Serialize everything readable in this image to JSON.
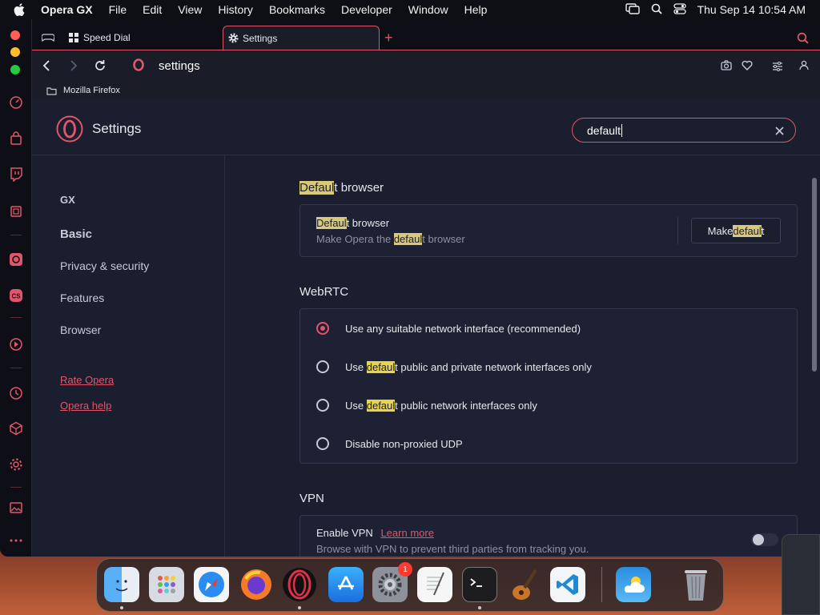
{
  "menubar": {
    "app_name": "Opera GX",
    "menus": [
      "File",
      "Edit",
      "View",
      "History",
      "Bookmarks",
      "Developer",
      "Window",
      "Help"
    ],
    "clock": "Thu Sep 14  10:54 AM"
  },
  "tabs": [
    {
      "label": "Speed Dial",
      "icon": "grid-icon"
    },
    {
      "label": "Settings",
      "icon": "gear-icon"
    }
  ],
  "toolbar": {
    "address": "settings"
  },
  "bookmarks": [
    {
      "label": "Mozilla Firefox",
      "icon": "folder-icon"
    }
  ],
  "settings_header": {
    "title": "Settings"
  },
  "search": {
    "value": "default"
  },
  "nav": {
    "items": [
      "GX",
      "Basic",
      "Privacy & security",
      "Features",
      "Browser"
    ],
    "links": [
      "Rate Opera",
      "Opera help"
    ]
  },
  "sections": {
    "default_browser": {
      "title_hl": "Defaul",
      "title_rest": "t browser",
      "row_title_hl": "Defaul",
      "row_title_rest": "t browser",
      "row_desc_pre": "Make Opera the ",
      "row_desc_hl": "defaul",
      "row_desc_rest": "t browser",
      "button_pre": "Make ",
      "button_hl": "defaul",
      "button_rest": "t"
    },
    "webrtc": {
      "title": "WebRTC",
      "options": [
        {
          "pre": "Use any suitable network interface (recommended)",
          "hl": "",
          "post": "",
          "selected": true
        },
        {
          "pre": "Use ",
          "hl": "defaul",
          "post": "t public and private network interfaces only",
          "selected": false
        },
        {
          "pre": "Use ",
          "hl": "defaul",
          "post": "t public network interfaces only",
          "selected": false
        },
        {
          "pre": "Disable non-proxied UDP",
          "hl": "",
          "post": "",
          "selected": false
        }
      ]
    },
    "vpn": {
      "title": "VPN",
      "enable_label": "Enable VPN",
      "learn_more": "Learn more",
      "desc": "Browse with VPN to prevent third parties from tracking you.",
      "enabled": false
    }
  },
  "dock": {
    "apps": [
      "Finder",
      "Launchpad",
      "Safari",
      "Firefox",
      "Opera GX",
      "App Store",
      "System Settings",
      "TextEdit",
      "Terminal",
      "GarageBand",
      "Visual Studio Code",
      "Weather",
      "Trash"
    ],
    "system_settings_badge": "1"
  },
  "colors": {
    "accent": "#e0566a",
    "highlight": "#e8d34a",
    "panel": "#1b1e2e"
  }
}
